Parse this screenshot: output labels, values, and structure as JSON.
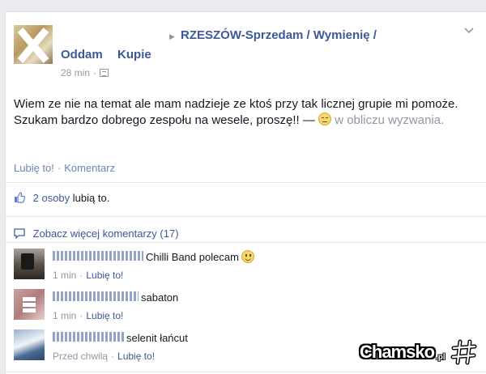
{
  "post": {
    "poster_name": "Oddam",
    "poster_name_tail": "Kupie",
    "group_name": "RZESZÓW-Sprzedam / Wymienię /",
    "time": "28 min",
    "text_main": "Wiem ze nie na temat ale mam nadzieje ze ktoś przy tak licznej grupie mi pomoże. Szukam bardzo dobrego zespołu na wesele, proszę!! —",
    "text_tail": "w obliczu wyzwania.",
    "like_label": "Lubię to!",
    "comment_label": "Komentarz"
  },
  "likes": {
    "count_text": "2 osoby",
    "suffix": "lubią to."
  },
  "more_comments": "Zobacz więcej komentarzy (17)",
  "comments": [
    {
      "text": "Chilli Band polecam",
      "time": "1 min",
      "like_label": "Lubię to!"
    },
    {
      "text": "sabaton",
      "time": "1 min",
      "like_label": "Lubię to!"
    },
    {
      "text": "selenit łańcut",
      "time": "Przed chwilą",
      "like_label": "Lubię to!"
    }
  ],
  "watermark": {
    "text": "Chamsko",
    "suffix": ".pl"
  },
  "colors": {
    "link_blue": "#3b5998",
    "muted_blue": "#6d84b4",
    "meta_gray": "#9197a3",
    "background": "#e9ebee"
  }
}
